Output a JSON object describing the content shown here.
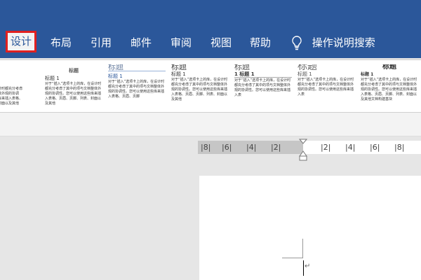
{
  "ribbon": {
    "tabs": [
      "设计",
      "布局",
      "引用",
      "邮件",
      "审阅",
      "视图",
      "帮助"
    ],
    "search_label": "操作说明搜索",
    "accent": "#2b579a"
  },
  "gallery": {
    "styles": [
      {
        "title": "",
        "heading": "",
        "body": "选项卡上的库，在设计时都充分考虑了其中的项与文档整体外观的协调性。您可以使用这些库来插入表格、页眉、页脚、列表、封面以及其他"
      },
      {
        "title": "标题",
        "heading": "标题 1",
        "body": "对于“插入”选项卡上的库，在设计时都充分考虑了其中的项与文档整体外观的协调性。您可以使用这些库来插入表格、页眉、页脚、列表、封面以及其他"
      },
      {
        "title": "标题",
        "heading": "标题 1",
        "body": "对于“插入”选项卡上的库，在设计时都充分考虑了其中的项与文档整体外观的协调性。您可以使用这些库来插入表格、页眉、页脚"
      },
      {
        "title": "标题",
        "heading": "标题 1",
        "body": "对于“插入”选项卡上的库，在设计时都充分考虑了其中的项与文档整体外观的协调性。您可以使用这些库来插入表格、页眉、页脚、列表、封面以及其他"
      },
      {
        "title": "标题",
        "heading": "1  标题 1",
        "body": "对于“插入”选项卡上的库，在设计时都充分考虑了其中的项与文档整体外观的协调性。您可以使用这些库来插入表"
      },
      {
        "title": "标题",
        "heading": "标题 1",
        "body": "对于“插入”选项卡上的库，在设计时都充分考虑了其中的项与文档整体外观的协调性。您可以使用这些库来插入表"
      },
      {
        "title": "标题",
        "heading": "标题 1",
        "body": "对于“插入”选项卡上的库，在设计时都充分考虑了其中的项与文档整体外观的协调性。您可以使用这些库来插入表格、页眉、页脚、列表、封面以及其他文档构建基块"
      }
    ]
  },
  "ruler": {
    "left": [
      "8",
      "6",
      "4",
      "2"
    ],
    "right": [
      "2",
      "4",
      "6",
      "8"
    ]
  },
  "document": {
    "paragraph_mark": "↵"
  }
}
